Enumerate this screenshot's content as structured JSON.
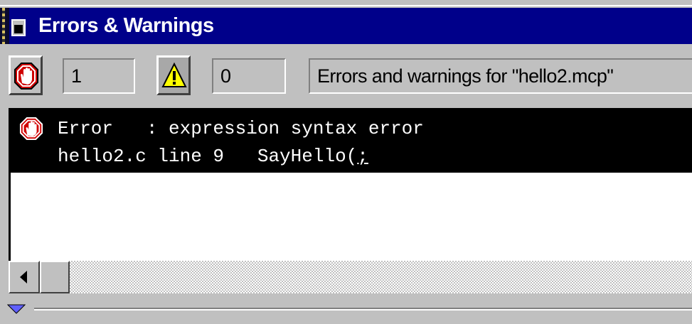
{
  "window": {
    "title": "Errors & Warnings"
  },
  "toolbar": {
    "error_button_icon": "stop-hand-icon",
    "error_count": "1",
    "warning_button_icon": "warning-triangle-icon",
    "warning_count": "0",
    "description": "Errors and warnings for \"hello2.mcp\""
  },
  "messages": [
    {
      "icon": "stop-hand-icon",
      "line1": "Error   : expression syntax error",
      "line2_prefix": "hello2.c line 9   SayHello(",
      "line2_underlined": ";",
      "selected": true
    }
  ],
  "colors": {
    "titlebar": "#00008a",
    "selection": "#000000",
    "error_red": "#c00000",
    "warning_yellow": "#ffff00"
  }
}
